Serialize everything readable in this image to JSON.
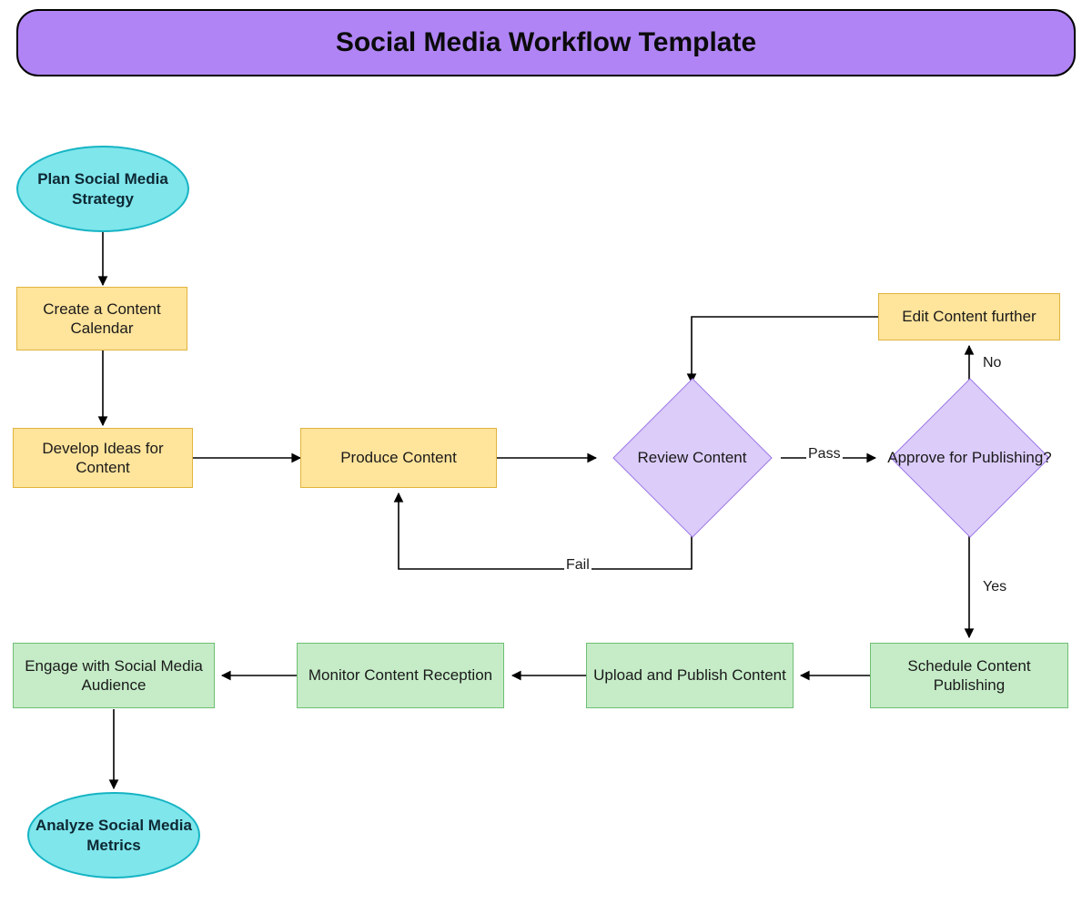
{
  "title": "Social Media Workflow Template",
  "nodes": {
    "start": "Plan Social Media Strategy",
    "calendar": "Create a Content Calendar",
    "develop": "Develop Ideas for Content",
    "produce": "Produce Content",
    "review": "Review Content",
    "approve": "Approve for Publishing?",
    "edit": "Edit Content further",
    "schedule": "Schedule Content Publishing",
    "upload": "Upload and Publish Content",
    "monitor": "Monitor Content Reception",
    "engage": "Engage with Social Media Audience",
    "analyze": "Analyze Social Media Metrics"
  },
  "edges": {
    "pass": "Pass",
    "fail": "Fail",
    "yes": "Yes",
    "no": "No"
  },
  "colors": {
    "title_bg": "#b084f5",
    "ellipse_fill": "#7fe6ec",
    "ellipse_stroke": "#16b4c4",
    "rect_yellow_fill": "#ffe49b",
    "rect_yellow_stroke": "#e2b43e",
    "rect_green_fill": "#c5ecc7",
    "rect_green_stroke": "#6fbf73",
    "diamond_fill": "#dcccfa",
    "diamond_stroke": "#9b77e6"
  }
}
